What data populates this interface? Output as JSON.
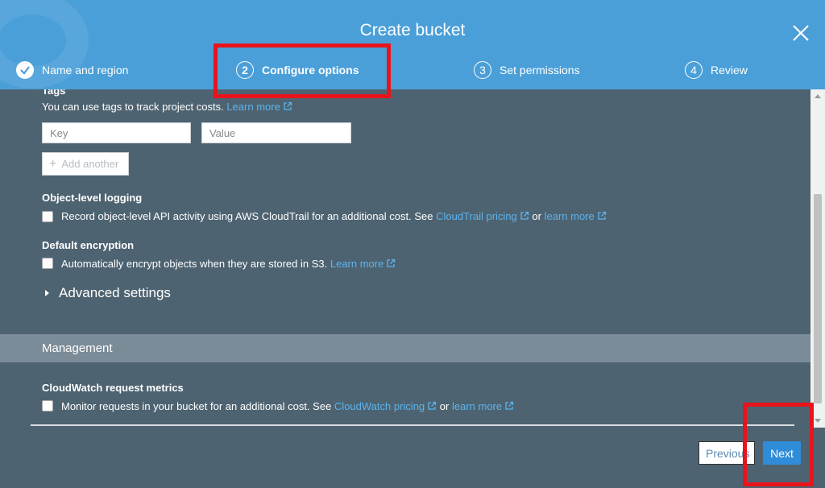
{
  "header": {
    "title": "Create bucket",
    "close_icon": "close-icon",
    "steps": [
      {
        "number": "",
        "label": "Name and region",
        "state": "done"
      },
      {
        "number": "2",
        "label": "Configure options",
        "state": "active"
      },
      {
        "number": "3",
        "label": "Set permissions",
        "state": "pending"
      },
      {
        "number": "4",
        "label": "Review",
        "state": "pending"
      }
    ]
  },
  "tags": {
    "heading": "Tags",
    "description": "You can use tags to track project costs.",
    "learn_more": "Learn more",
    "key_placeholder": "Key",
    "value_placeholder": "Value",
    "add_label": "Add another"
  },
  "logging": {
    "heading": "Object-level logging",
    "text": "Record object-level API activity using AWS CloudTrail for an additional cost. See",
    "pricing_link": "CloudTrail pricing",
    "or": "or",
    "learn_more": "learn more"
  },
  "encryption": {
    "heading": "Default encryption",
    "text": "Automatically encrypt objects when they are stored in S3.",
    "learn_more": "Learn more"
  },
  "advanced": {
    "label": "Advanced settings"
  },
  "management": {
    "heading": "Management",
    "cloudwatch_heading": "CloudWatch request metrics",
    "text": "Monitor requests in your bucket for an additional cost. See",
    "pricing_link": "CloudWatch pricing",
    "or": "or",
    "learn_more": "learn more"
  },
  "footer": {
    "previous_label": "Previous",
    "next_label": "Next"
  },
  "colors": {
    "header": "#4a9fd8",
    "body": "#4e6371",
    "link": "#5ab4ef",
    "primary": "#2e8cd8",
    "highlight": "#e8131b"
  }
}
